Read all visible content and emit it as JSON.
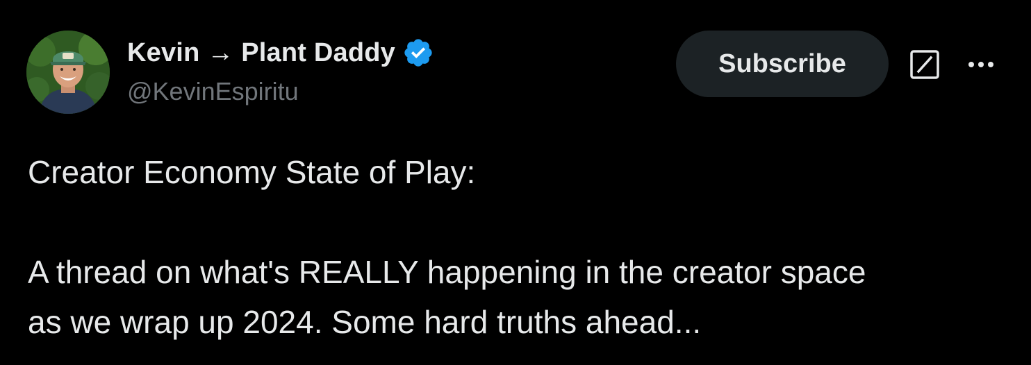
{
  "author": {
    "display_name": "Kevin → Plant Daddy",
    "handle": "@KevinEspiritu",
    "verified": true,
    "avatar_icon": "profile-photo"
  },
  "actions": {
    "subscribe_label": "Subscribe",
    "grok_icon": "grok-icon",
    "more_icon": "more-options-icon"
  },
  "tweet": {
    "line1": "Creator Economy State of Play:",
    "line2": "A thread on what's REALLY happening in the creator space",
    "line3": "as we wrap up 2024. Some hard truths ahead..."
  },
  "colors": {
    "background": "#000000",
    "text_primary": "#e7e9ea",
    "text_secondary": "#71767b",
    "button_bg": "#1c2225",
    "verified_blue": "#1d9bf0"
  }
}
